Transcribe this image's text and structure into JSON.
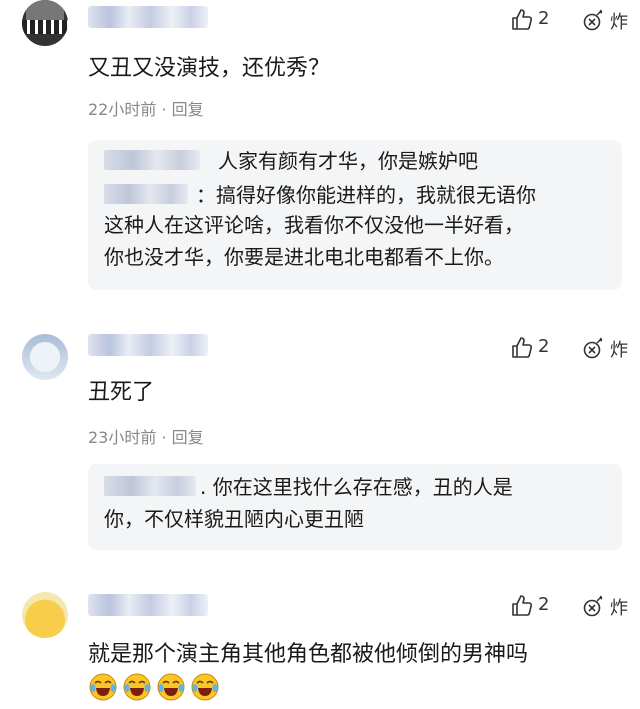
{
  "comments": [
    {
      "likes": "2",
      "bomb_label": "炸",
      "text": "又丑又没演技，还优秀？",
      "time": "22小时前",
      "reply_action": "回复",
      "replies": [
        {
          "text": "人家有颜有才华，你是嫉妒吧"
        },
        {
          "lines": [
            "：搞得好像你能进样的，我就很无语你",
            "这种人在这评论啥，我看你不仅没他一半好看，",
            "你也没才华，你要是进北电北电都看不上你。"
          ]
        }
      ]
    },
    {
      "likes": "2",
      "bomb_label": "炸",
      "text": "丑死了",
      "time": "23小时前",
      "reply_action": "回复",
      "replies": [
        {
          "lines": [
            ". 你在这里找什么存在感，丑的人是",
            "你，不仅样貌丑陋内心更丑陋"
          ]
        }
      ]
    },
    {
      "likes": "2",
      "bomb_label": "炸",
      "text": "就是那个演主角其他角色都被他倾倒的男神吗",
      "emojis": [
        "crying-laughing-emoji",
        "crying-laughing-emoji",
        "crying-laughing-emoji",
        "crying-laughing-emoji"
      ]
    }
  ],
  "meta_sep": " · ",
  "icons": {
    "like": "thumbs-up-icon",
    "bomb": "bomb-icon"
  }
}
